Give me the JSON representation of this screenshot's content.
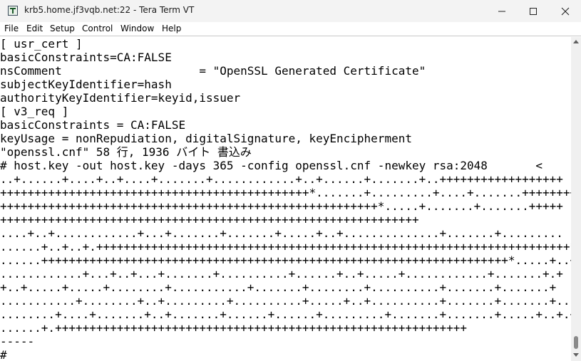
{
  "window": {
    "title": "krb5.home.jf3vqb.net:22 - Tera Term VT",
    "app_icon": "teraterm-icon",
    "controls": {
      "minimize_icon": "minimize-icon",
      "maximize_icon": "maximize-icon",
      "close_icon": "close-icon"
    }
  },
  "menu": {
    "items": [
      {
        "label": "File"
      },
      {
        "label": "Edit"
      },
      {
        "label": "Setup"
      },
      {
        "label": "Control"
      },
      {
        "label": "Window"
      },
      {
        "label": "Help"
      }
    ]
  },
  "terminal": {
    "lines": [
      "[ usr_cert ]",
      "basicConstraints=CA:FALSE",
      "nsComment                    = \"OpenSSL Generated Certificate\"",
      "subjectKeyIdentifier=hash",
      "authorityKeyIdentifier=keyid,issuer",
      "[ v3_req ]",
      "basicConstraints = CA:FALSE",
      "keyUsage = nonRepudiation, digitalSignature, keyEncipherment",
      "\"openssl.cnf\" 58 行, 1936 バイト 書込み",
      "# host.key -out host.key -days 365 -config openssl.cnf -newkey rsa:2048       <",
      "..+......+....+..+....+.......+............+..+......+.......+..++++++++++++++++++",
      "+++++++++++++++++++++++++++++++++++++++++++++*.......+.........+....+.......++++++++++",
      "+++++++++++++++++++++++++++++++++++++++++++++++++++++++*.....+.......+.......+++++",
      "+++++++++++++++++++++++++++++++++++++++++++++++++++++++++++++",
      "....+..+............+...+.......+.......+.....+..+..............+.......+.........",
      "......+..+..+.+++++++++++++++++++++++++++++++++++++++++++++++++++++++++++++++++++++*",
      "......++++++++++++++++++++++++++++++++++++++++++++++++++++++++++++++++++++*.....+..+",
      "............+...+..+...+.......+..........+......+..+.....+............+.......+.+",
      "+..+.....+.....+........+...........+.......+........+..........+.......+.......+",
      "...........+........+..+.........+..........+.....+..+..........+.......+.......+...+",
      "........+....+.......+..+.......+......+......+.........+.......+.......+.....+..+.+.+",
      "......+.++++++++++++++++++++++++++++++++++++++++++++++++++++++++++++",
      "-----",
      "#"
    ]
  },
  "scrollbar": {
    "up_icon": "scroll-up-arrow-icon",
    "down_icon": "scroll-down-arrow-icon"
  }
}
